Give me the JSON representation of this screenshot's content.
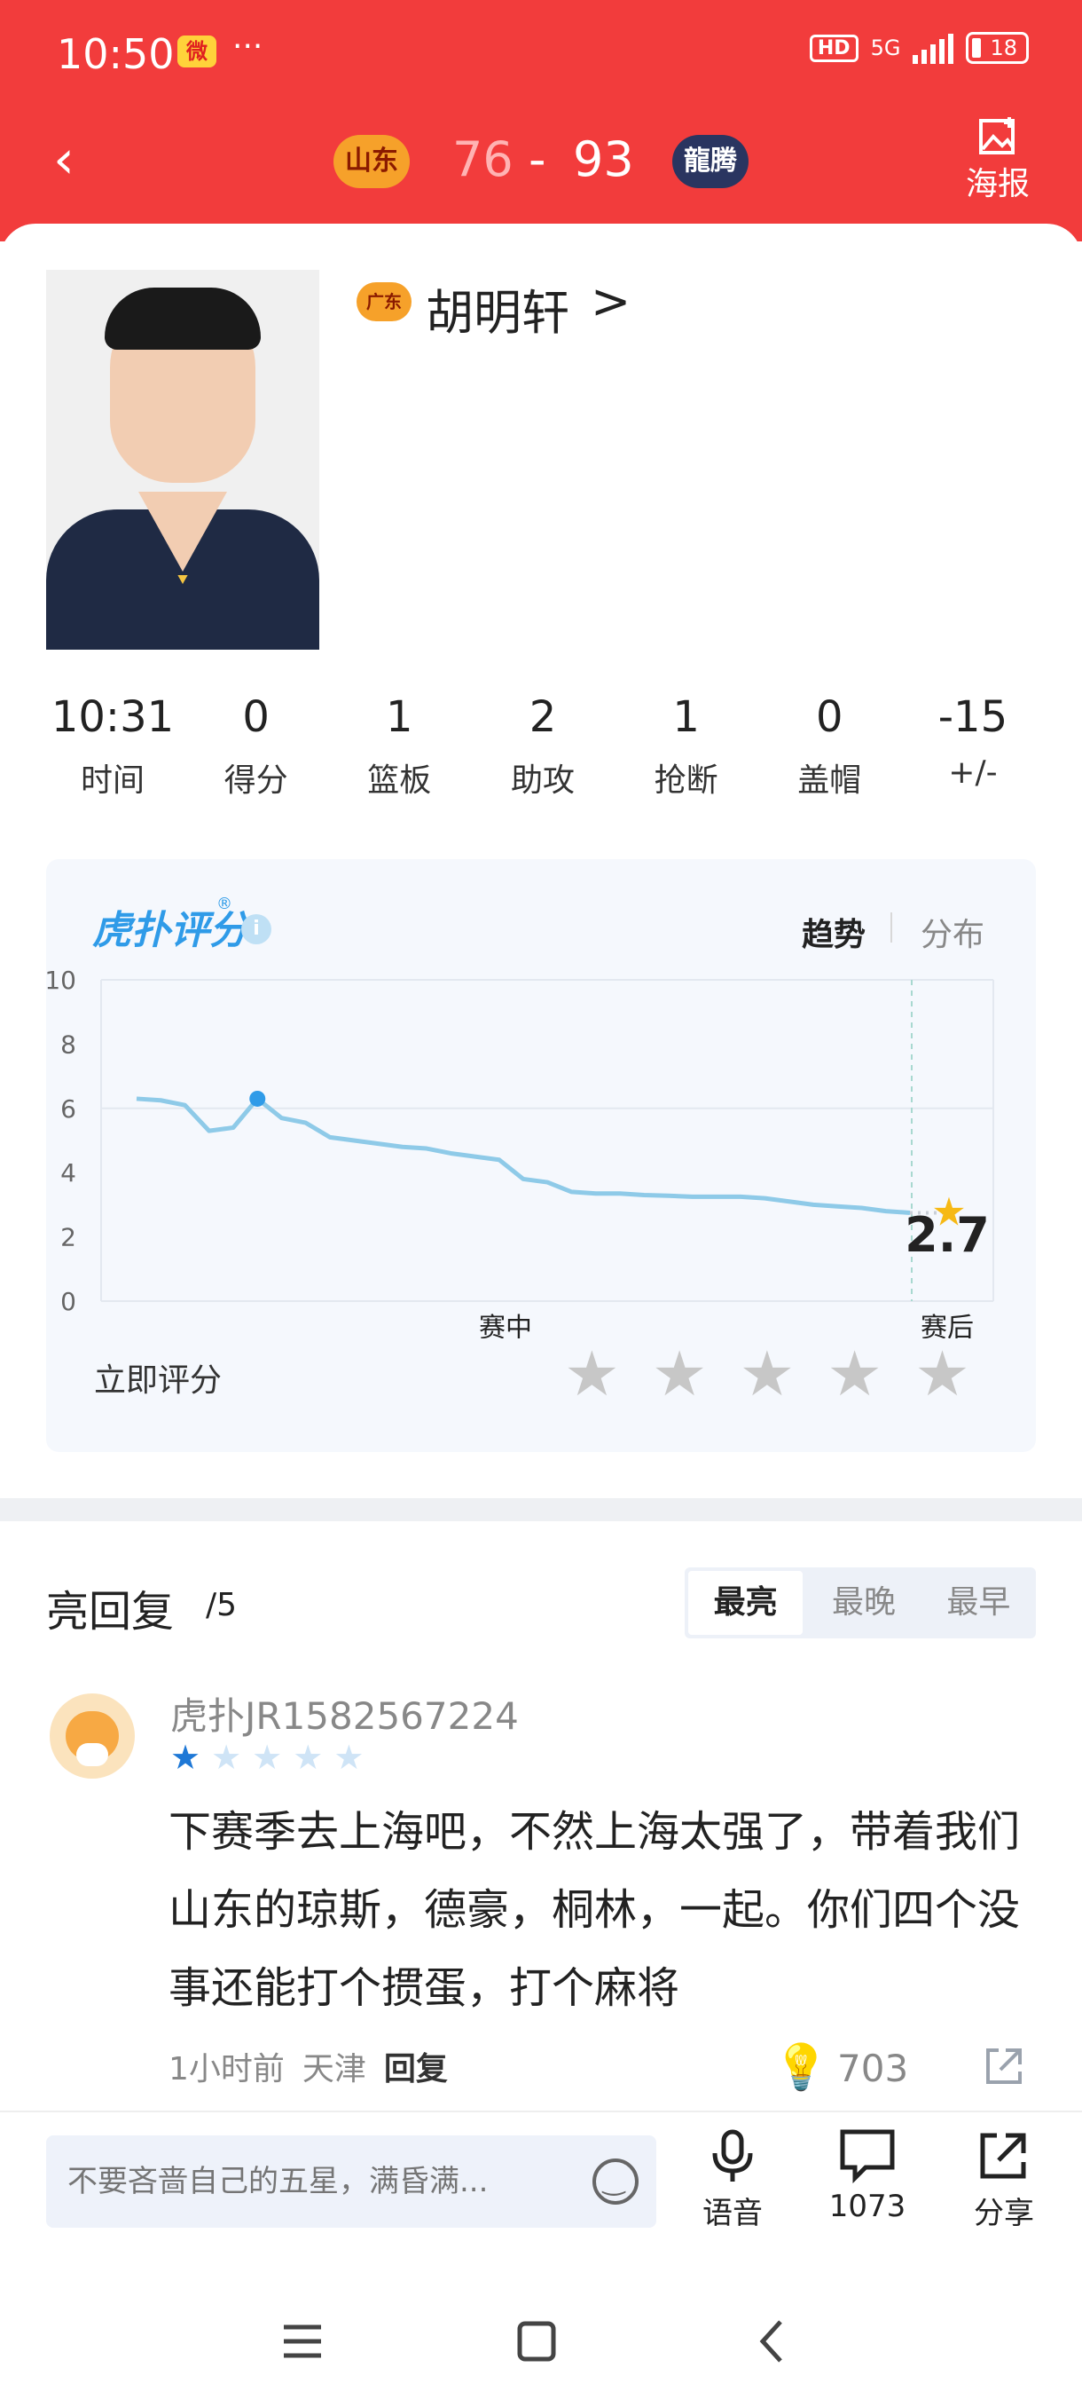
{
  "status_bar": {
    "time": "10:50",
    "app_icon": "weibo-icon",
    "dots": "···",
    "hd": "HD",
    "network": "5G",
    "battery": "18"
  },
  "header": {
    "home_team_logo": "山东",
    "away_team_logo": "龍腾",
    "home_score": "76",
    "separator": "-",
    "away_score": "93",
    "poster_label": "海报"
  },
  "player": {
    "name": "胡明轩",
    "chevron": ">",
    "team_icon": "广东"
  },
  "stats": [
    {
      "value": "10:31",
      "label": "时间"
    },
    {
      "value": "0",
      "label": "得分"
    },
    {
      "value": "1",
      "label": "篮板"
    },
    {
      "value": "2",
      "label": "助攻"
    },
    {
      "value": "1",
      "label": "抢断"
    },
    {
      "value": "0",
      "label": "盖帽"
    },
    {
      "value": "-15",
      "label": "+/-"
    }
  ],
  "rating": {
    "logo": "虎扑评分",
    "logo_reg": "®",
    "info": "i",
    "tab_trend": "趋势",
    "tab_dist": "分布",
    "rate_now": "立即评分"
  },
  "chart_data": {
    "type": "line",
    "title": "",
    "xlabel": "",
    "ylabel": "",
    "ylim": [
      0,
      10
    ],
    "y_ticks": [
      "10",
      "8",
      "6",
      "4",
      "2",
      "0"
    ],
    "x_tick_labels": [
      "赛中",
      "赛后"
    ],
    "final_value": "2.7",
    "series": [
      {
        "values": [
          6.3,
          6.25,
          6.1,
          5.3,
          5.4,
          6.3,
          5.7,
          5.55,
          5.1,
          5.0,
          4.9,
          4.8,
          4.75,
          4.6,
          4.5,
          4.4,
          3.8,
          3.7,
          3.4,
          3.35,
          3.35,
          3.3,
          3.28,
          3.25,
          3.25,
          3.25,
          3.2,
          3.1,
          3.0,
          2.95,
          2.9,
          2.8,
          2.75
        ]
      }
    ],
    "highlight_index": 5,
    "accent_color": "#8ecae8",
    "star_color": "#f6b915"
  },
  "replies": {
    "title": "亮回复",
    "count": "/5",
    "sort_tabs": [
      "最亮",
      "最晚",
      "最早"
    ],
    "comment": {
      "user": "虎扑JR1582567224",
      "rating_stars": 1,
      "text": "下赛季去上海吧，不然上海太强了，带着我们山东的琼斯，德豪，桐林，一起。你们四个没事还能打个掼蛋，打个麻将",
      "time": "1小时前",
      "location": "天津",
      "reply": "回复",
      "likes": "703"
    }
  },
  "bottom_bar": {
    "input_placeholder": "不要吝啬自己的五星，满昏满...",
    "voice": "语音",
    "comments": "1073",
    "share": "分享"
  }
}
